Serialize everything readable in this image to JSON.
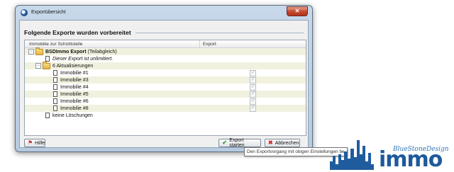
{
  "window": {
    "title": "Exportübersicht",
    "close_symbol": "✕"
  },
  "heading": "Folgende Exporte wurden vorbereitet",
  "columns": [
    "Immobilie zur Schnittstelle",
    "Export"
  ],
  "tree": {
    "root_name": "BSDImmo Export",
    "root_suffix": "(Teilabgleich)",
    "root_note": "Dieser Export ist unlimitiert.",
    "updates_label": "6 Aktualisierungen",
    "items": [
      "Immobilie #1",
      "Immobilie #3",
      "Immobilie #4",
      "Immobilie #5",
      "Immobilie #6",
      "Immobilie #8"
    ],
    "deletions_label": "keine Löschungen"
  },
  "buttons": {
    "help": "Hilfe",
    "start": "Export starten",
    "cancel": "Abbrechen"
  },
  "tooltip": "Den Exportvorgang mit obigen Einstellungen be",
  "logo": {
    "tagline": "BlueStoneDesign",
    "word": "immo"
  }
}
